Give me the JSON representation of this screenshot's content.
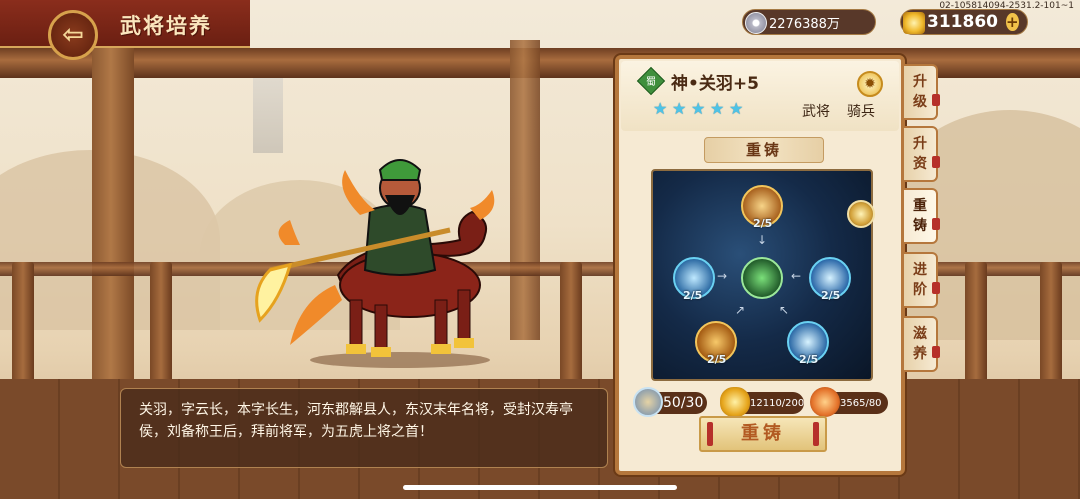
{
  "header": {
    "title": "武将培养",
    "back_icon": "back-arrow-icon",
    "build_id": "02-105814094-2531.2-101~1"
  },
  "currencies": {
    "silver": {
      "icon": "silver-coin-icon",
      "value": "2276388万"
    },
    "gold": {
      "icon": "gold-ingot-icon",
      "value": "311860",
      "add_label": "+"
    }
  },
  "hero": {
    "faction": "蜀",
    "name": "神•关羽+5",
    "stars": 5,
    "role": "武将",
    "unit_type": "骑兵",
    "bio": "关羽，字云长，本字长生，河东郡解县人，东汉末年名将，受封汉寿亭侯，刘备称王后，拜前将军，为五虎上将之首！"
  },
  "reforge": {
    "section_title": "重铸",
    "nodes": [
      {
        "id": "top",
        "label": "2/5",
        "icon": "armor-skill-icon"
      },
      {
        "id": "left",
        "label": "2/5",
        "icon": "slash-skill-icon"
      },
      {
        "id": "center",
        "label": "",
        "icon": "hero-core-icon"
      },
      {
        "id": "right",
        "label": "2/5",
        "icon": "horse-skill-icon"
      },
      {
        "id": "bottom-left",
        "label": "2/5",
        "icon": "shield-skill-icon"
      },
      {
        "id": "bottom-right",
        "label": "2/5",
        "icon": "boot-skill-icon"
      }
    ],
    "costs": {
      "fragment": "50/30",
      "gold": "12110/200",
      "orb": "3565/80"
    },
    "button_label": "重铸"
  },
  "tabs": [
    {
      "label": "升级",
      "active": false
    },
    {
      "label": "升资",
      "active": false
    },
    {
      "label": "重铸",
      "active": true
    },
    {
      "label": "进阶",
      "active": false
    },
    {
      "label": "滋养",
      "active": false
    }
  ]
}
